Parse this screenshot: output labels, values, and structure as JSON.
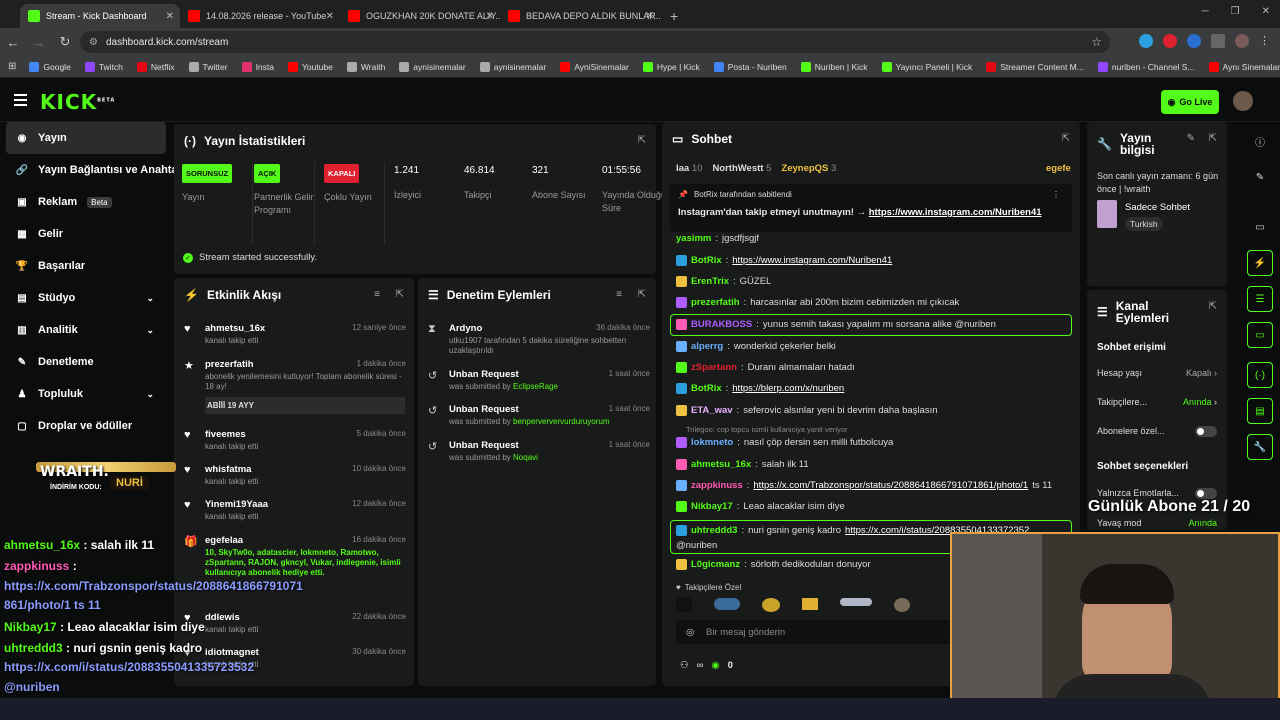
{
  "tabs": [
    {
      "label": "Stream - Kick Dashboard",
      "color": "#53fc18",
      "active": true
    },
    {
      "label": "14.08.2026 release - YouTube",
      "color": "#ff0000"
    },
    {
      "label": "OGUZKHAN 20K DONATE ALIY...",
      "color": "#ff0000"
    },
    {
      "label": "BEDAVA DEPO ALDIK BUNLAR...",
      "color": "#ff0000"
    }
  ],
  "url": "dashboard.kick.com/stream",
  "bookmarks": [
    {
      "label": "Google",
      "c": "#4285f4"
    },
    {
      "label": "Twitch",
      "c": "#9146ff"
    },
    {
      "label": "Netflix",
      "c": "#e50914"
    },
    {
      "label": "Twitter",
      "c": "#aaa"
    },
    {
      "label": "Insta",
      "c": "#e1306c"
    },
    {
      "label": "Youtube",
      "c": "#ff0000"
    },
    {
      "label": "Wraith",
      "c": "#aaa"
    },
    {
      "label": "aynisinemalar",
      "c": "#aaa"
    },
    {
      "label": "aynisinemalar",
      "c": "#aaa"
    },
    {
      "label": "AyniSinemalar",
      "c": "#ff0000"
    },
    {
      "label": "Hype | Kick",
      "c": "#53fc18"
    },
    {
      "label": "Posta - Nuriben",
      "c": "#4285f4"
    },
    {
      "label": "Nuriben | Kick",
      "c": "#53fc18"
    },
    {
      "label": "Yayıncı Paneli | Kick",
      "c": "#53fc18"
    },
    {
      "label": "Streamer Content M...",
      "c": "#e50914"
    },
    {
      "label": "nuriben - Channel S...",
      "c": "#9146ff"
    },
    {
      "label": "Aynı Sinemalar - Ça...",
      "c": "#ff0000"
    }
  ],
  "logo": "KICK",
  "logo_beta": "BETA",
  "go_live": "Go Live",
  "sidebar": [
    {
      "label": "Yayın",
      "active": true,
      "icon": "◉"
    },
    {
      "label": "Yayın Bağlantısı ve Anahtar",
      "icon": "🔗"
    },
    {
      "label": "Reklam",
      "badge": "Beta",
      "icon": "▣"
    },
    {
      "label": "Gelir",
      "icon": "▦"
    },
    {
      "label": "Başarılar",
      "icon": "🏆"
    },
    {
      "label": "Stüdyo",
      "chev": true,
      "icon": "▤"
    },
    {
      "label": "Analitik",
      "chev": true,
      "icon": "▥"
    },
    {
      "label": "Denetleme",
      "icon": "✎"
    },
    {
      "label": "Topluluk",
      "chev": true,
      "icon": "♟"
    },
    {
      "label": "Droplar ve ödüller",
      "icon": "▢"
    }
  ],
  "stats": {
    "title": "Yayın İstatistikleri",
    "items": [
      {
        "badge": "SORUNSUZ",
        "bc": "#53fc18",
        "label": "Yayın"
      },
      {
        "badge": "AÇIK",
        "bc": "#53fc18",
        "label": "Partnerlik Gelir Programı"
      },
      {
        "badge": "KAPALI",
        "bc": "#e0212f",
        "label": "Çoklu Yayın"
      },
      {
        "num": "1.241",
        "label": "İzleyici"
      },
      {
        "num": "46.814",
        "label": "Takipçi"
      },
      {
        "num": "321",
        "label": "Abone Sayısı"
      },
      {
        "num": "01:55:56",
        "label": "Yayında Olduğu Süre"
      }
    ],
    "success": "Stream started successfully."
  },
  "activity": {
    "title": "Etkinlik Akışı",
    "items": [
      {
        "name": "ahmetsu_16x",
        "time": "12 saniye önce",
        "desc": "kanalı takip etti",
        "icon": "♥"
      },
      {
        "name": "prezerfatih",
        "time": "1 dakika önce",
        "desc": "abonelik yenilemesini kutluyor! Toplam abonelik süresi - 18 ay!",
        "icon": "★",
        "extra": "ABİİİ 19 AYY"
      },
      {
        "name": "fiveemes",
        "time": "5 dakika önce",
        "desc": "kanalı takip etti",
        "icon": "♥"
      },
      {
        "name": "whisfatma",
        "time": "10 dakika önce",
        "desc": "kanalı takip etti",
        "icon": "♥"
      },
      {
        "name": "Yinemi19Yaaa",
        "time": "12 dakika önce",
        "desc": "kanalı takip etti",
        "icon": "♥"
      },
      {
        "name": "egefelaa",
        "time": "16 dakika önce",
        "desc": "10, SkyTw0o, adatascier, lokmneto, Ramotwo, zSpartann, RAJON, gkncyl, Vukar, indlegenie, isimli kullanıcıya abonelik hediye etti.",
        "icon": "🎁"
      },
      {
        "name": "ddlewis",
        "time": "22 dakika önce",
        "desc": "kanalı takip etti",
        "icon": "♥"
      },
      {
        "name": "idiotmagnet",
        "time": "30 dakika önce",
        "desc": "kanalı takip etti",
        "icon": "♥"
      }
    ]
  },
  "moderation": {
    "title": "Denetim Eylemleri",
    "items": [
      {
        "name": "Ardyno",
        "time": "36 dakika önce",
        "desc": "utku1907 tarafından 5 dakika süreliğine sohbetten uzaklaştırıldı",
        "icon": "⧗"
      },
      {
        "name": "Unban Request",
        "time": "1 saat önce",
        "desc": "was submitted by ",
        "who": "EclipseRage",
        "icon": "↺"
      },
      {
        "name": "Unban Request",
        "time": "1 saat önce",
        "desc": "was submitted by ",
        "who": "benperververvurduruyorum",
        "icon": "↺"
      },
      {
        "name": "Unban Request",
        "time": "1 saat önce",
        "desc": "was submitted by ",
        "who": "Noqavi",
        "icon": "↺"
      }
    ]
  },
  "chat": {
    "title": "Sohbet",
    "top": [
      {
        "n": "Iaa",
        "c": "10"
      },
      {
        "n": "NorthWestt",
        "c": "5"
      },
      {
        "n": "ZeynepQS",
        "c": "3"
      },
      {
        "n": "egefe"
      }
    ],
    "pinned_by": "BotRix tarafından sabitlendi",
    "pinned_text": "Instagram'dan takip etmeyi unutmayın! → ",
    "pinned_link": "https://www.instagram.com/Nuriben41",
    "messages": [
      {
        "u": "yasimm",
        "uc": "#53fc18",
        "t": "jgsdfjsgjf"
      },
      {
        "u": "BotRix",
        "uc": "#53fc18",
        "t": "",
        "link": "https://www.instagram.com/Nuriben41"
      },
      {
        "u": "ErenTrix",
        "uc": "#53fc18",
        "t": "GÜZEL"
      },
      {
        "u": "prezerfatih",
        "uc": "#53fc18",
        "t": "harcasınlar abi 200m bizim cebimizden mi çıkıcak"
      },
      {
        "u": "BURAKBOSS",
        "uc": "#b05cff",
        "t": "yunus semih takası yapalım mı sorsana alike @nuriben",
        "hl": true
      },
      {
        "u": "alperrg",
        "uc": "#6ab0ff",
        "t": "wonderkid çekerler belki"
      },
      {
        "u": "zSpartann",
        "uc": "#e0212f",
        "t": "Duranı almamaları hatadı"
      },
      {
        "u": "BotRix",
        "uc": "#53fc18",
        "t": "",
        "link": "https://blerp.com/x/nuriben"
      },
      {
        "u": "ETA_wav",
        "uc": "#e8b0ff",
        "t": "seferovic alsınlar   yeni bi devrim daha başlasın"
      },
      {
        "u": "lokmneto",
        "uc": "#6ab0ff",
        "t": "nasıl çöp dersin sen milli futbolcuya",
        "reply": "Trilegoo: cop topcu isimli kullaniciya yanit veriyor"
      },
      {
        "u": "ahmetsu_16x",
        "uc": "#53fc18",
        "t": "salah ilk 11"
      },
      {
        "u": "zappkinuss",
        "uc": "#ff5ab4",
        "t": " ts 11",
        "link": "https://x.com/Trabzonspor/status/2088641866791071861/photo/1"
      },
      {
        "u": "Nikbay17",
        "uc": "#53fc18",
        "t": "Leao alacaklar isim diye"
      },
      {
        "u": "uhtreddd3",
        "uc": "#53fc18",
        "t": "nuri gsnin geniş kadro ",
        "link": "https://x.com/i/status/208835504133372352",
        "t2": "@nuriben",
        "hl": true
      },
      {
        "u": "L0gicmanz",
        "uc": "#53fc18",
        "t": "sörloth dedikoduları donuyor"
      }
    ],
    "followers_only": "Takipçilere Özel",
    "input_placeholder": "Bir mesaj gönderin",
    "count": "0"
  },
  "stream_info": {
    "title": "Yayın bilgisi",
    "last": "Son canlı yayın zamanı: 6 gün önce | !wraith",
    "category": "Sadece Sohbet",
    "lang": "Turkish"
  },
  "channel": {
    "title": "Kanal Eylemleri",
    "chat_access": "Sohbet erişimi",
    "age_label": "Hesap yaşı",
    "age_val": "Kapalı",
    "followers_label": "Takipçilere...",
    "followers_val": "Anında",
    "subs_label": "Abonelere özel...",
    "chat_opts": "Sohbet seçenekleri",
    "emote_label": "Yalnızca Emotlarla...",
    "slow_label": "Yavaş mod",
    "slow_val": "Anında"
  },
  "overlay": {
    "daily": "Günlük Abone 21 / 20",
    "wraith": "WRAITH.",
    "wraith_code": "İNDİRİM KODU:",
    "wraith_nuri": "NURİ",
    "lines": [
      {
        "u": "ahmetsu_16x",
        "t": " : salah ilk 11",
        "c": "#53fc18"
      },
      {
        "u": "zappkinuss",
        "t": " :",
        "c": "#ff5ab4"
      },
      {
        "t": "https://x.com/Trabzonspor/status/2088641866791071",
        "c": "#8a9cff"
      },
      {
        "t": "861/photo/1 ts 11",
        "c": "#8a9cff"
      },
      {
        "u": "Nikbay17",
        "t": " : Leao alacaklar isim diye",
        "c": "#53fc18"
      },
      {
        "u": "uhtreddd3",
        "t": " : nuri gsnin geniş kadro",
        "c": "#53fc18"
      },
      {
        "t": "https://x.com/i/status/2088355041335723532",
        "c": "#8a9cff"
      },
      {
        "t": "@nuriben",
        "c": "#8a9cff"
      },
      {
        "u": "L0gicmanz",
        "t": " : sörloth dedikoduları donuyor",
        "c": "#53fc18"
      }
    ]
  }
}
